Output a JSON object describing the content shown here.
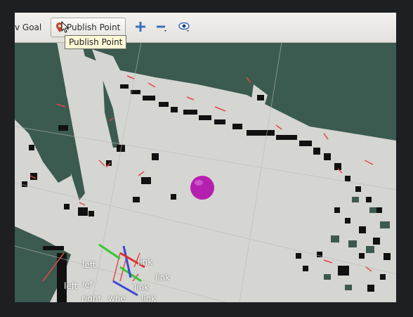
{
  "toolbar": {
    "nav_goal_label": "v Goal",
    "publish_point_label": "Publish Point",
    "tooltip": "Publish Point",
    "icons": [
      "map-pin-icon",
      "mouse-cursor-icon",
      "move-camera-plus-icon",
      "zoom-minus-icon",
      "visibility-eye-icon"
    ]
  },
  "scene": {
    "goal_marker_color": "#b51fb0",
    "floor_color": "#d5d5d1",
    "unknown_space_color": "#3b5a50",
    "obstacle_color": "#111111",
    "laser_color": "#e04a4a",
    "frame_labels": [
      "left",
      "lef",
      "link",
      "left",
      "link",
      "link",
      "right",
      "whe",
      "link"
    ]
  }
}
